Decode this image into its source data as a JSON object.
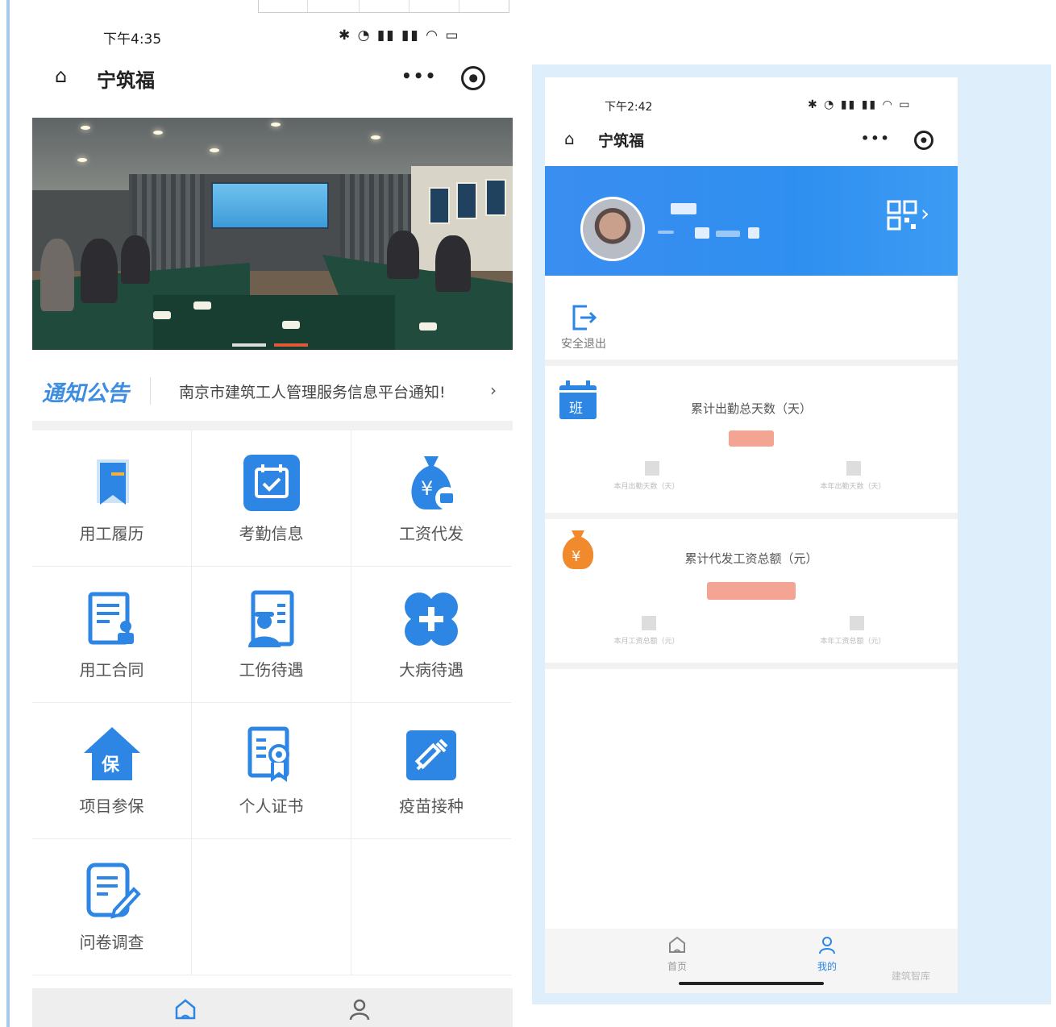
{
  "left_phone": {
    "status": {
      "time": "下午4:35",
      "icons": "✱ ◔ ▮▮ ▮▮ ◠ ▭"
    },
    "nav": {
      "title": "宁筑福",
      "more": "•••"
    },
    "notice": {
      "title": "通知公告",
      "text": "南京市建筑工人管理服务信息平台通知!",
      "arrow": "›"
    },
    "menu": [
      {
        "label": "用工履历",
        "icon": "bookmark-icon"
      },
      {
        "label": "考勤信息",
        "icon": "calendar-check-icon"
      },
      {
        "label": "工资代发",
        "icon": "money-bag-icon"
      },
      {
        "label": "用工合同",
        "icon": "contract-icon"
      },
      {
        "label": "工伤待遇",
        "icon": "worker-id-icon"
      },
      {
        "label": "大病待遇",
        "icon": "medical-cross-icon"
      },
      {
        "label": "项目参保",
        "icon": "insurance-house-icon"
      },
      {
        "label": "个人证书",
        "icon": "certificate-icon"
      },
      {
        "label": "疫苗接种",
        "icon": "syringe-icon"
      },
      {
        "label": "问卷调查",
        "icon": "survey-icon"
      }
    ]
  },
  "right_phone": {
    "status": {
      "time": "下午2:42",
      "icons": "✱ ◔ ▮▮ ▮▮ ◠ ▭"
    },
    "nav": {
      "title": "宁筑福",
      "more": "•••"
    },
    "logout_label": "安全退出",
    "attendance": {
      "title": "累计出勤总天数（天）",
      "badge": "班",
      "sub_left": "本月出勤天数（天）",
      "sub_right": "本年出勤天数（天）"
    },
    "wage": {
      "title": "累计代发工资总额（元）",
      "badge": "¥",
      "sub_left": "本月工资总额（元）",
      "sub_right": "本年工资总额（元）"
    },
    "tabs": [
      {
        "label": "首页"
      },
      {
        "label": "我的"
      }
    ],
    "watermark": "建筑智库"
  },
  "colors": {
    "accent": "#2d86e3",
    "orange": "#f08a2c",
    "profile_bg": "#3a8ef0"
  }
}
